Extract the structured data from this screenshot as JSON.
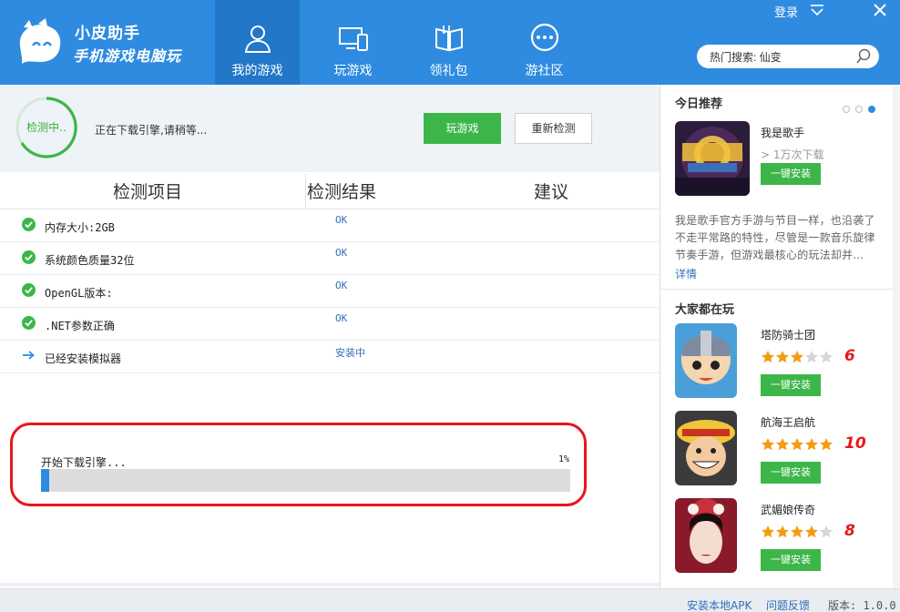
{
  "app": {
    "title": "小皮助手",
    "subtitle": "手机游戏电脑玩"
  },
  "nav": {
    "tabs": [
      {
        "label": "我的游戏",
        "icon": "user-icon",
        "active": true
      },
      {
        "label": "玩游戏",
        "icon": "devices-icon",
        "active": false
      },
      {
        "label": "领礼包",
        "icon": "book-icon",
        "active": false
      },
      {
        "label": "游社区",
        "icon": "chat-icon",
        "active": false
      }
    ]
  },
  "window": {
    "login_label": "登录"
  },
  "search": {
    "value": "热门搜索: 仙变"
  },
  "status": {
    "ring_text": "检测中..",
    "message": "正在下载引擎,请稍等...",
    "play_button": "玩游戏",
    "recheck_button": "重新检测"
  },
  "table": {
    "headers": [
      "检测项目",
      "检测结果",
      "建议"
    ],
    "rows": [
      {
        "label": "内存大小:2GB",
        "result": "OK",
        "icon": "check-icon"
      },
      {
        "label": "系统颜色质量32位",
        "result": "OK",
        "icon": "check-icon"
      },
      {
        "label": "OpenGL版本:",
        "result": "OK",
        "icon": "check-icon"
      },
      {
        "label": ".NET参数正确",
        "result": "OK",
        "icon": "check-icon"
      },
      {
        "label": "已经安装模拟器",
        "result": "安装中",
        "icon": "arrow-right-icon"
      }
    ]
  },
  "progress": {
    "label": "开始下载引擎...",
    "percent_text": "1%",
    "percent": 1
  },
  "recommend": {
    "title": "今日推荐",
    "game_name": "我是歌手",
    "downloads": "> 1万次下载",
    "install": "一键安装",
    "description": "我是歌手官方手游与节目一样，也沿袭了不走平常路的特性，尽管是一款音乐旋律节奏手游，但游戏最核心的玩法却并...",
    "more": "详情",
    "pager_dots": 3,
    "pager_active": 3
  },
  "popular": {
    "title": "大家都在玩",
    "items": [
      {
        "name": "塔防骑士团",
        "stars": 3,
        "score": "6",
        "install": "一键安装"
      },
      {
        "name": "航海王启航",
        "stars": 5,
        "score": "10",
        "install": "一键安装"
      },
      {
        "name": "武媚娘传奇",
        "stars": 4,
        "score": "8",
        "install": "一键安装"
      }
    ]
  },
  "footer": {
    "install_apk": "安装本地APK",
    "feedback": "问题反馈",
    "version": "版本: 1.0.0"
  },
  "colors": {
    "header_blue": "#2e8be0",
    "active_tab": "#2277c9",
    "green": "#3cb648",
    "alert_red": "#e8161a",
    "star_orange": "#f39c12"
  }
}
